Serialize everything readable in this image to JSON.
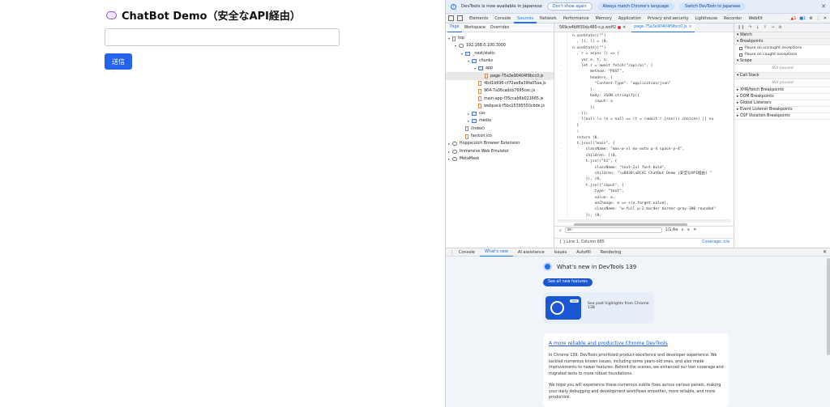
{
  "app": {
    "title": "ChatBot Demo（安全なAPI経由）",
    "input_value": "",
    "send_label": "送信"
  },
  "devtools": {
    "infobar": {
      "message": "DevTools is now available in Japanese",
      "dont_show": "Don't show again",
      "always_match": "Always match Chrome's language",
      "switch": "Switch DevTools to Japanese"
    },
    "tabs": [
      "Elements",
      "Console",
      "Sources",
      "Network",
      "Performance",
      "Memory",
      "Application",
      "Privacy and security",
      "Lighthouse",
      "Recorder",
      "WebKit"
    ],
    "active_tab": "Sources",
    "issues": {
      "warnings": "1",
      "errors": "1"
    },
    "navigator": {
      "tabs": [
        "Page",
        "Workspace",
        "Overrides"
      ],
      "active": "Page",
      "tree": [
        {
          "label": "top",
          "depth": 0,
          "kind": "page",
          "arrow": "▾"
        },
        {
          "label": "192.168.0.100:3000",
          "depth": 1,
          "kind": "cloud",
          "arrow": "▾"
        },
        {
          "label": "_next/static",
          "depth": 2,
          "kind": "folder",
          "arrow": "▾"
        },
        {
          "label": "chunks",
          "depth": 3,
          "kind": "folder",
          "arrow": "▾"
        },
        {
          "label": "app",
          "depth": 4,
          "kind": "folder",
          "arrow": "▾"
        },
        {
          "label": "page-75a3e90404f9bcc0.js",
          "depth": 5,
          "kind": "file",
          "arrow": "",
          "selected": true
        },
        {
          "label": "4bd1b696-cf72ae8a39fa05aa.js",
          "depth": 4,
          "kind": "file",
          "arrow": ""
        },
        {
          "label": "964-7a36cadcb7695cec.js",
          "depth": 4,
          "kind": "file",
          "arrow": ""
        },
        {
          "label": "main-app-f35ccab6b021665.js",
          "depth": 4,
          "kind": "file",
          "arrow": ""
        },
        {
          "label": "webpack-f5bc15395550cbde.js",
          "depth": 4,
          "kind": "file",
          "arrow": ""
        },
        {
          "label": "css",
          "depth": 3,
          "kind": "folder",
          "arrow": "▸"
        },
        {
          "label": "media",
          "depth": 3,
          "kind": "folder",
          "arrow": "▸"
        },
        {
          "label": "(index)",
          "depth": 2,
          "kind": "page",
          "arrow": ""
        },
        {
          "label": "favicon.ico",
          "depth": 2,
          "kind": "file",
          "arrow": ""
        },
        {
          "label": "Hoppscotch Browser Extension",
          "depth": 0,
          "kind": "cloud",
          "arrow": "▸"
        },
        {
          "label": "Immersive Web Emulator",
          "depth": 0,
          "kind": "cloud",
          "arrow": "▸"
        },
        {
          "label": "MetaMask",
          "depth": 0,
          "kind": "cloud",
          "arrow": "▸"
        }
      ]
    },
    "editor": {
      "tabs": [
        {
          "label": "569ce4b8f30dc480-s.p.woff2",
          "error": true
        },
        {
          "label": "page-75a3e90404f9bcc0.js",
          "active": true
        }
      ],
      "lines": [
        "n.useState)(\"\")",
        "  , [i, l] = (0,",
        "n.useState)(\"\")",
        "  , r = async () => {",
        "    var e, t, n;",
        "    let r = await fetch(\"/api/ai\", {",
        "        method: \"POST\",",
        "        headers: {",
        "          \"Content-Type\": \"application/json\"",
        "        },",
        "        body: JSON.stringify({",
        "          input: a",
        "        })",
        "    });",
        "    l(null != (n = null == (t = (await r.json()).choices) || nu",
        "  }",
        "  ;",
        "  return (0,",
        "  t.jsxs)(\"main\", {",
        "      className: \"max-w-xl mx-auto p-4 space-y-4\",",
        "      children: [(0,",
        "      t.jsx)(\"h1\", {",
        "          className: \"text-2xl font-bold\",",
        "          children: \"\\uD83D\\uDCAC ChatBot Demo (安全なAPI経由) \"",
        "      }), (0,",
        "      t.jsx)(\"input\", {",
        "          type: \"text\",",
        "          value: a,",
        "          onChange: e => s(e.target.value),",
        "          className: \"w-full p-2 border border-gray-300 rounded\"",
        "      }), (0,",
        "      t.jsx)(\"button\", {"
      ],
      "search_value": "ak-",
      "search_flags": "1/1  Aa",
      "cursor": "Line 1, Column 685",
      "coverage": "Coverage: n/a"
    },
    "debugger": {
      "sections": [
        "Watch",
        "Breakpoints"
      ],
      "pause_uncaught": "Pause on uncaught exceptions",
      "pause_caught": "Pause on caught exceptions",
      "scope": "Scope",
      "scope_note": "Not paused",
      "call_stack": "Call Stack",
      "call_note": "Not paused",
      "more": [
        "XHR/fetch Breakpoints",
        "DOM Breakpoints",
        "Global Listeners",
        "Event Listener Breakpoints",
        "CSP Violation Breakpoints"
      ]
    },
    "drawer": {
      "tabs": [
        "Console",
        "What's new",
        "AI assistance",
        "Issues",
        "Autofill",
        "Rendering"
      ],
      "active": "What's new",
      "heading": "What's new in DevTools 139",
      "see_all": "See all new features",
      "highlight_tag": "new",
      "highlight_text": "See past highlights from Chrome 138",
      "article_title": "A more reliable and productive Chrome DevTools",
      "paragraph1": "In Chrome 139, DevTools prioritized product excellence and developer experience. We tackled numerous known issues, including some years-old ones, and also made improvements to newer features. Behind the scenes, we enhanced our test coverage and migrated tests to more robust foundations.",
      "paragraph2": "We hope you will experience these numerous subtle fixes across various panels, making your daily debugging and development workflows smoother, more reliable, and more productive."
    }
  }
}
